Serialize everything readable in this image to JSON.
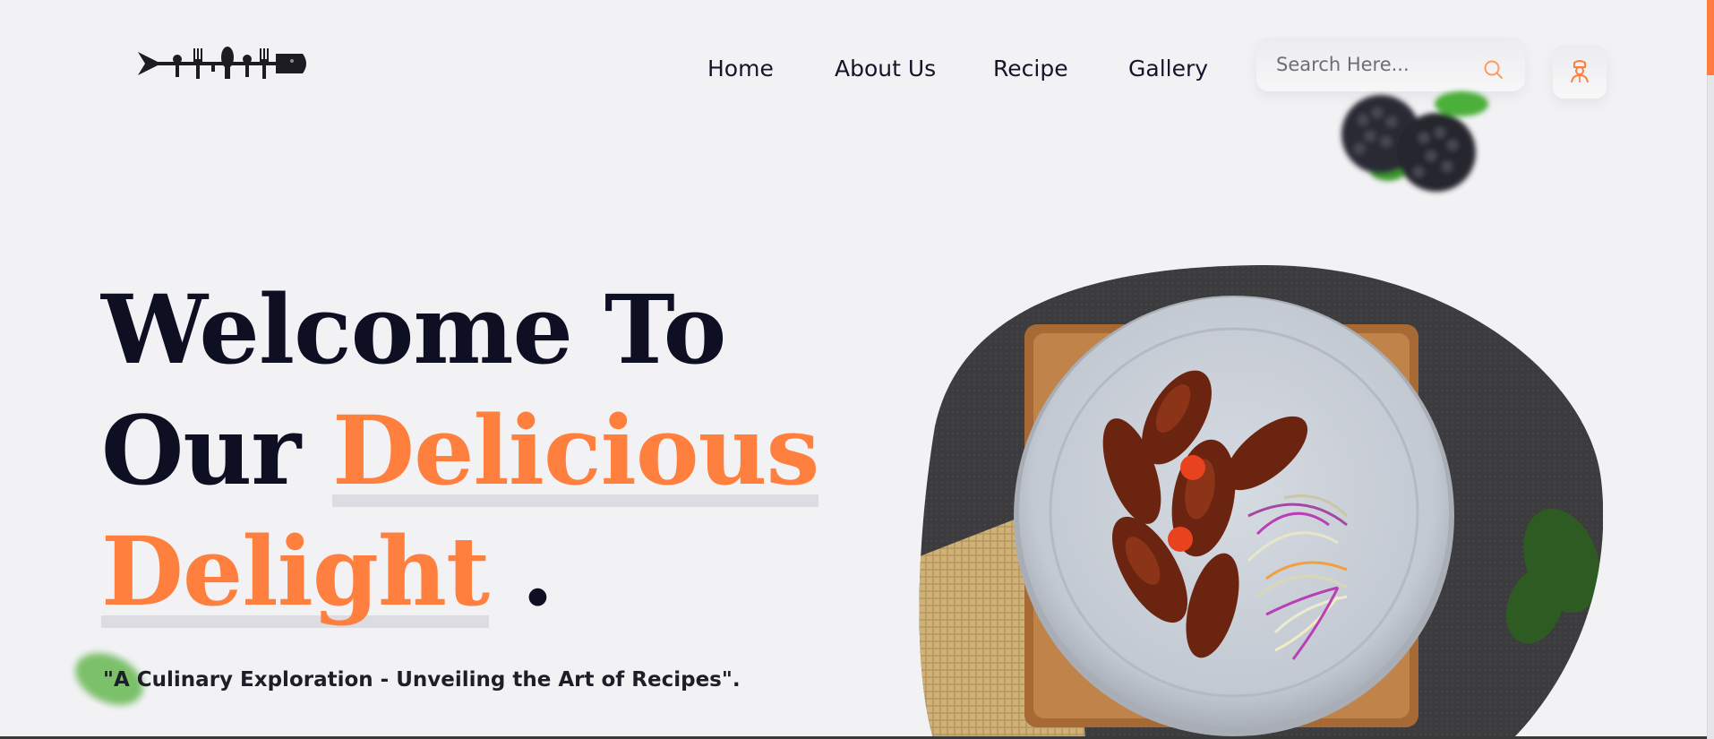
{
  "logo": {
    "icon": "fish-utensils-logo-icon"
  },
  "nav": {
    "items": [
      {
        "label": "Home"
      },
      {
        "label": "About Us"
      },
      {
        "label": "Recipe"
      },
      {
        "label": "Gallery"
      }
    ]
  },
  "search": {
    "placeholder": "Search Here...",
    "icon": "search-icon"
  },
  "user_button": {
    "icon": "chef-user-icon"
  },
  "hero": {
    "line1": "Welcome To",
    "line2_prefix": "Our ",
    "line2_accent": "Delicious",
    "line3_accent": "Delight",
    "line3_suffix": " .",
    "tagline": "\"A Culinary Exploration - Unveiling the Art of Recipes\"."
  },
  "colors": {
    "accent": "#ff7f3e",
    "text_dark": "#0f0f24",
    "background": "#f2f2f5"
  }
}
